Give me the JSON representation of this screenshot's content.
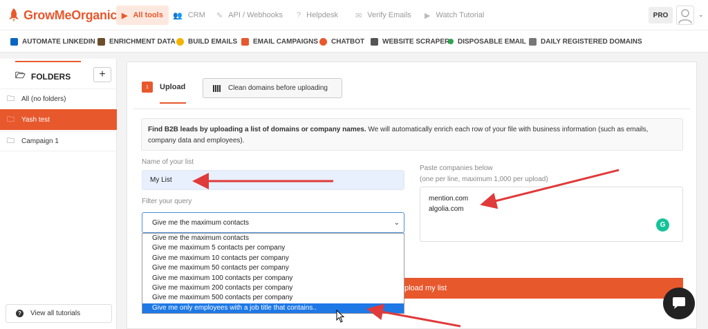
{
  "brand": {
    "name": "GrowMeOrganic",
    "accent": "#e8582d"
  },
  "topnav": [
    {
      "label": "All tools",
      "icon": "play-icon",
      "active": true
    },
    {
      "label": "CRM",
      "icon": "users-icon"
    },
    {
      "label": "API / Webhooks",
      "icon": "wrench-icon"
    },
    {
      "label": "Helpdesk",
      "icon": "help-icon"
    },
    {
      "label": "Verify Emails",
      "icon": "envelope-icon"
    },
    {
      "label": "Watch Tutorial",
      "icon": "play-icon"
    }
  ],
  "account": {
    "plan": "PRO"
  },
  "tools": [
    {
      "label": "AUTOMATE LINKEDIN",
      "color": "#0a66c2"
    },
    {
      "label": "ENRICHMENT DATA",
      "color": "#6b4f2a"
    },
    {
      "label": "BUILD EMAILS",
      "color": "#f4b400"
    },
    {
      "label": "EMAIL CAMPAIGNS",
      "color": "#e8582d"
    },
    {
      "label": "CHATBOT",
      "color": "#e8582d"
    },
    {
      "label": "WEBSITE SCRAPER",
      "color": "#555555"
    },
    {
      "label": "DISPOSABLE EMAIL",
      "color": "#2ea44f"
    },
    {
      "label": "DAILY REGISTERED DOMAINS",
      "color": "#777777"
    }
  ],
  "sidebar": {
    "title": "FOLDERS",
    "add_label": "+",
    "folders": [
      {
        "label": "All (no folders)",
        "selected": false
      },
      {
        "label": "Yash test",
        "selected": true
      },
      {
        "label": "Campaign 1",
        "selected": false
      }
    ],
    "tutorials_label": "View all tutorials"
  },
  "main": {
    "tab_step": "1",
    "tab_upload": "Upload",
    "clean_button": "Clean domains before uploading",
    "info_bold": "Find B2B leads by uploading a list of domains or company names.",
    "info_rest": " We will automatically enrich each row of your file with business information (such as emails, company data and employees).",
    "name_label": "Name of your list",
    "name_value": "My List",
    "filter_label": "Filter your query",
    "filter_selected": "Give me the maximum contacts",
    "filter_options": [
      "Give me the maximum contacts",
      "Give me maximum 5 contacts per company",
      "Give me maximum 10 contacts per company",
      "Give me maximum 50 contacts per company",
      "Give me maximum 100 contacts per company",
      "Give me maximum 200 contacts per company",
      "Give me maximum 500 contacts per company",
      "Give me only employees with a job title that contains.."
    ],
    "highlighted_option_index": 7,
    "paste_label_1": "Paste companies below",
    "paste_label_2": "(one per line, maximum 1,000 per upload)",
    "paste_lines": [
      "mention.com",
      "algolia.com"
    ],
    "upload_button": "pload my list"
  }
}
